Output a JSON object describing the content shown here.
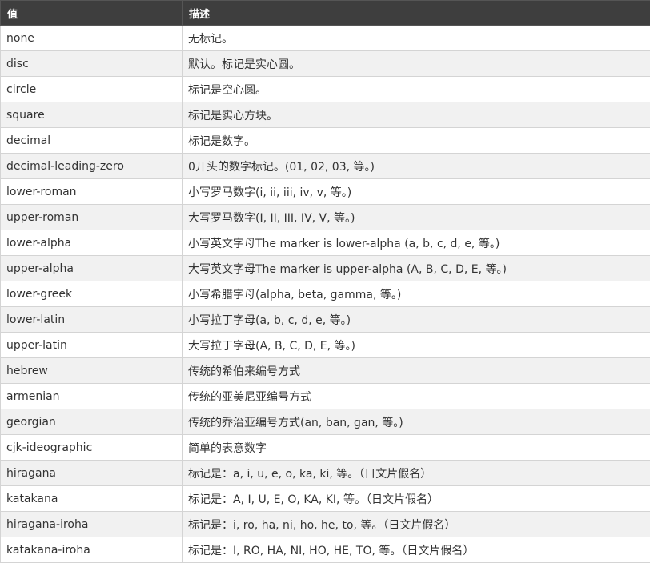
{
  "table": {
    "headers": [
      "值",
      "描述"
    ],
    "rows": [
      {
        "value": "none",
        "description": "无标记。"
      },
      {
        "value": "disc",
        "description": "默认。标记是实心圆。"
      },
      {
        "value": "circle",
        "description": "标记是空心圆。"
      },
      {
        "value": "square",
        "description": "标记是实心方块。"
      },
      {
        "value": "decimal",
        "description": "标记是数字。"
      },
      {
        "value": "decimal-leading-zero",
        "description": "0开头的数字标记。(01, 02, 03, 等。)"
      },
      {
        "value": "lower-roman",
        "description": "小写罗马数字(i, ii, iii, iv, v, 等。)"
      },
      {
        "value": "upper-roman",
        "description": "大写罗马数字(I, II, III, IV, V, 等。)"
      },
      {
        "value": "lower-alpha",
        "description": "小写英文字母The marker is lower-alpha (a, b, c, d, e, 等。)"
      },
      {
        "value": "upper-alpha",
        "description": "大写英文字母The marker is upper-alpha (A, B, C, D, E, 等。)"
      },
      {
        "value": "lower-greek",
        "description": "小写希腊字母(alpha, beta, gamma, 等。)"
      },
      {
        "value": "lower-latin",
        "description": "小写拉丁字母(a, b, c, d, e, 等。)"
      },
      {
        "value": "upper-latin",
        "description": "大写拉丁字母(A, B, C, D, E, 等。)"
      },
      {
        "value": "hebrew",
        "description": "传统的希伯来编号方式"
      },
      {
        "value": "armenian",
        "description": "传统的亚美尼亚编号方式"
      },
      {
        "value": "georgian",
        "description": "传统的乔治亚编号方式(an, ban, gan, 等。)"
      },
      {
        "value": "cjk-ideographic",
        "description": "简单的表意数字"
      },
      {
        "value": "hiragana",
        "description": "标记是：a, i, u, e, o, ka, ki, 等。（日文片假名）"
      },
      {
        "value": "katakana",
        "description": "标记是：A, I, U, E, O, KA, KI, 等。（日文片假名）"
      },
      {
        "value": "hiragana-iroha",
        "description": "标记是：i, ro, ha, ni, ho, he, to, 等。（日文片假名）"
      },
      {
        "value": "katakana-iroha",
        "description": "标记是：I, RO, HA, NI, HO, HE, TO, 等。（日文片假名）"
      }
    ]
  }
}
